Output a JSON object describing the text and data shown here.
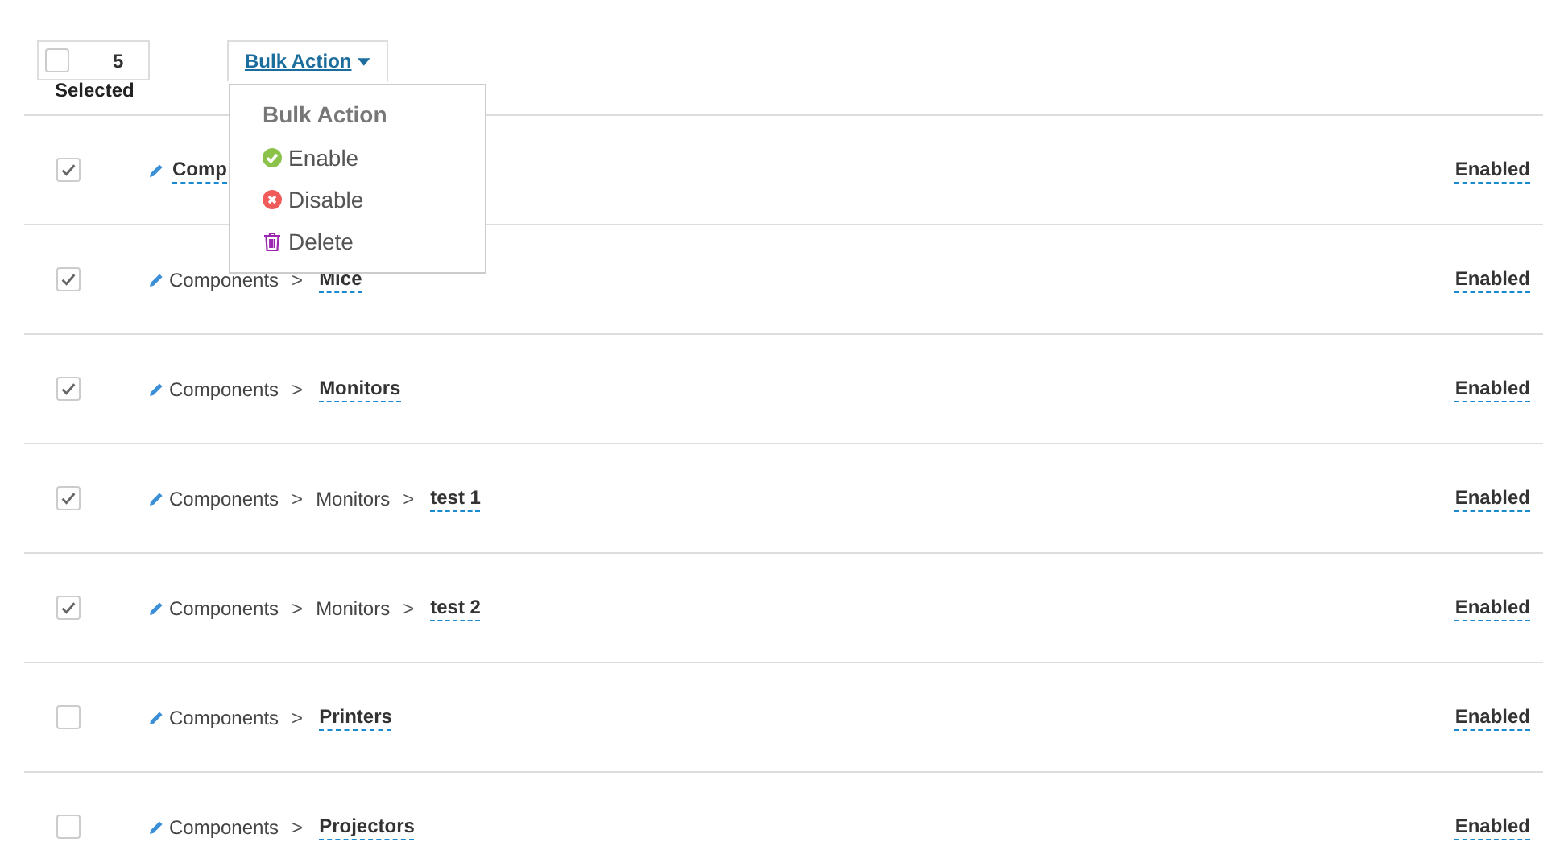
{
  "selection": {
    "checked": false,
    "count": "5",
    "label": "Selected"
  },
  "bulk_action": {
    "label": "Bulk Action",
    "expanded": true,
    "menu": {
      "header": "Bulk Action",
      "items": [
        {
          "kind": "enable",
          "label": "Enable"
        },
        {
          "kind": "disable",
          "label": "Disable"
        },
        {
          "kind": "delete",
          "label": "Delete"
        }
      ]
    }
  },
  "rows": [
    {
      "checked": true,
      "crumbs": [],
      "leaf": "Comp",
      "status": "Enabled"
    },
    {
      "checked": true,
      "crumbs": [
        {
          "label": "Components",
          "separator": ">"
        }
      ],
      "leaf": "Mice",
      "status": "Enabled"
    },
    {
      "checked": true,
      "crumbs": [
        {
          "label": "Components",
          "separator": ">"
        }
      ],
      "leaf": "Monitors",
      "status": "Enabled"
    },
    {
      "checked": true,
      "crumbs": [
        {
          "label": "Components",
          "separator": ">"
        },
        {
          "label": "Monitors",
          "separator": ">"
        }
      ],
      "leaf": "test 1",
      "status": "Enabled"
    },
    {
      "checked": true,
      "crumbs": [
        {
          "label": "Components",
          "separator": ">"
        },
        {
          "label": "Monitors",
          "separator": ">"
        }
      ],
      "leaf": "test 2",
      "status": "Enabled"
    },
    {
      "checked": false,
      "crumbs": [
        {
          "label": "Components",
          "separator": ">"
        }
      ],
      "leaf": "Printers",
      "status": "Enabled"
    },
    {
      "checked": false,
      "crumbs": [
        {
          "label": "Components",
          "separator": ">"
        }
      ],
      "leaf": "Projectors",
      "status": "Enabled"
    }
  ]
}
